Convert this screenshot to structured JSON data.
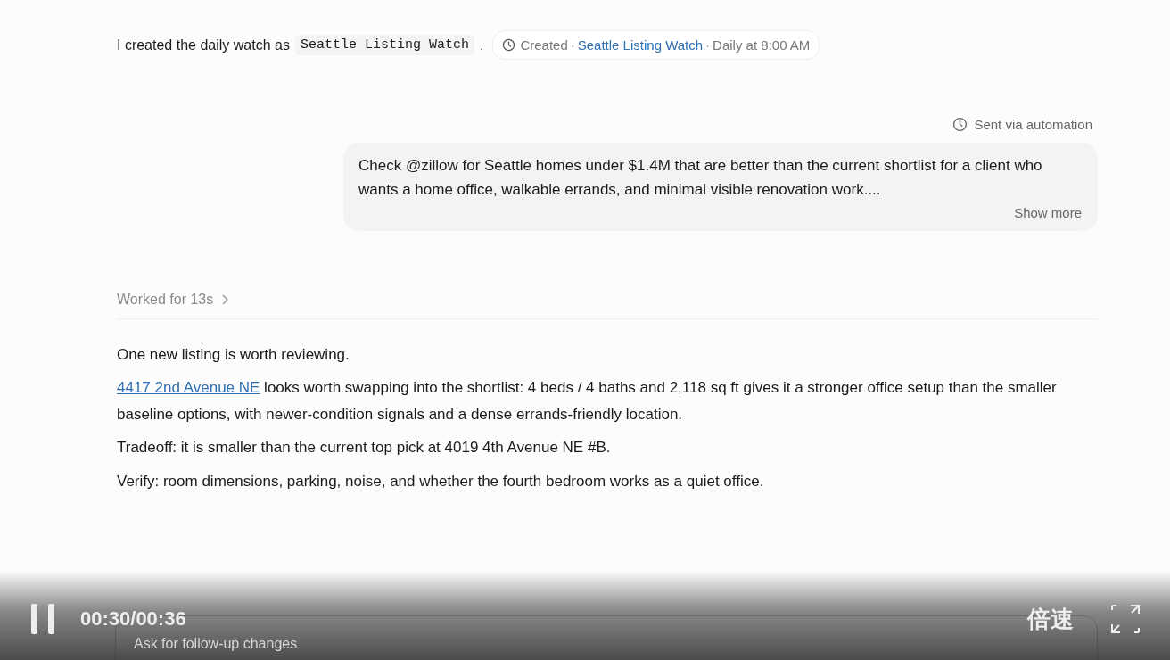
{
  "intro": {
    "text": "I created the daily watch as",
    "code": "Seattle Listing Watch",
    "end": "."
  },
  "created_chip": {
    "status": "Created",
    "separators": [
      "·",
      "·"
    ],
    "link": "Seattle Listing Watch",
    "schedule": "Daily at 8:00 AM"
  },
  "user_message": {
    "source": "Sent via automation",
    "text": "Check @zillow for Seattle homes under $1.4M that are better than the current shortlist for a client who wants a home office, walkable errands, and minimal visible renovation work....",
    "show_more": "Show more"
  },
  "worked": {
    "label": "Worked for 13s",
    "expanded": false
  },
  "answer": {
    "summary": "One new listing is worth reviewing.",
    "detail_link": "4417 2nd Avenue NE",
    "detail_text": " looks worth swapping into the shortlist: 4 beds / 4 baths and 2,118 sq ft gives it a stronger office setup than the smaller baseline options, with newer-condition signals and a dense errands-friendly location.",
    "tradeoff": "Tradeoff: it is smaller than the current top pick at 4019 4th Avenue NE #B.",
    "verify": "Verify: room dimensions, parking, noise, and whether the fourth bedroom works as a quiet office."
  },
  "composer": {
    "placeholder": "Ask for follow-up changes"
  },
  "player": {
    "playing": true,
    "time": "00:30/00:36",
    "speed": "倍速"
  }
}
